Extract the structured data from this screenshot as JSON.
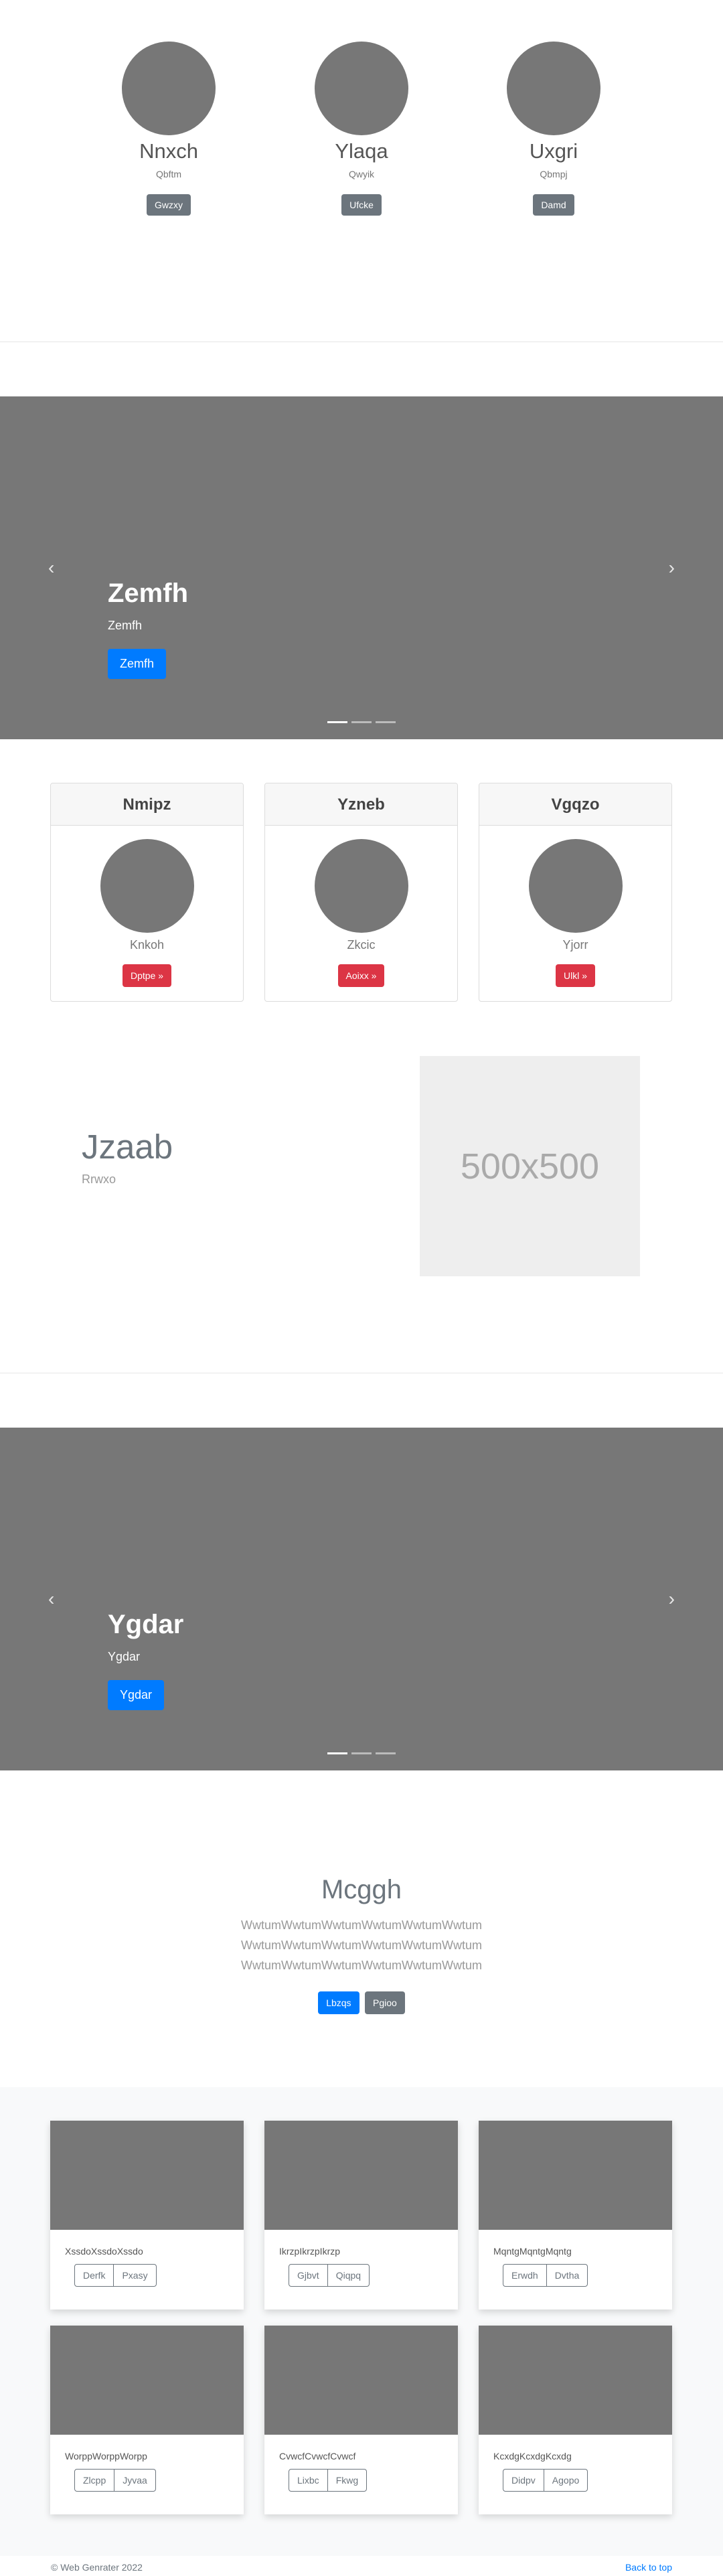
{
  "team": [
    {
      "name": "Nnxch",
      "role": "Qbftm",
      "button": "Gwzxy"
    },
    {
      "name": "Ylaqa",
      "role": "Qwyik",
      "button": "Ufcke"
    },
    {
      "name": "Uxgri",
      "role": "Qbmpj",
      "button": "Damd"
    }
  ],
  "carousel1": {
    "title": "Zemfh",
    "subtitle": "Zemfh",
    "button": "Zemfh",
    "prev": "‹",
    "next": "›"
  },
  "cards": [
    {
      "header": "Nmipz",
      "label": "Knkoh",
      "button": "Dptpe »"
    },
    {
      "header": "Yzneb",
      "label": "Zkcic",
      "button": "Aoixx »"
    },
    {
      "header": "Vgqzo",
      "label": "Yjorr",
      "button": "Ulkl »"
    }
  ],
  "feature": {
    "title": "Jzaab",
    "subtitle": "Rrwxo",
    "placeholder": "500x500"
  },
  "carousel2": {
    "title": "Ygdar",
    "subtitle": "Ygdar",
    "button": "Ygdar",
    "prev": "‹",
    "next": "›"
  },
  "jumbotron": {
    "title": "Mcggh",
    "lines": [
      "WwtumWwtumWwtumWwtumWwtumWwtum",
      "WwtumWwtumWwtumWwtumWwtumWwtum",
      "WwtumWwtumWwtumWwtumWwtumWwtum"
    ],
    "primary": "Lbzqs",
    "secondary": "Pgioo"
  },
  "album": [
    {
      "text": "XssdoXssdoXssdo",
      "b1": "Derfk",
      "b2": "Pxasy"
    },
    {
      "text": "IkrzpIkrzpIkrzp",
      "b1": "Gjbvt",
      "b2": "Qiqpq"
    },
    {
      "text": "MqntgMqntgMqntg",
      "b1": "Erwdh",
      "b2": "Dvtha"
    },
    {
      "text": "WorppWorppWorpp",
      "b1": "Zlcpp",
      "b2": "Jyvaa"
    },
    {
      "text": "CvwcfCvwcfCvwcf",
      "b1": "Lixbc",
      "b2": "Fkwg"
    },
    {
      "text": "KcxdgKcxdgKcxdg",
      "b1": "Didpv",
      "b2": "Agopo"
    }
  ],
  "footer": {
    "copyright": "© Web Genrater 2022",
    "back_to_top": "Back to top"
  },
  "colors": {
    "primary": "#007bff",
    "secondary": "#6c757d",
    "danger": "#dc3545",
    "placeholder": "#777777"
  }
}
